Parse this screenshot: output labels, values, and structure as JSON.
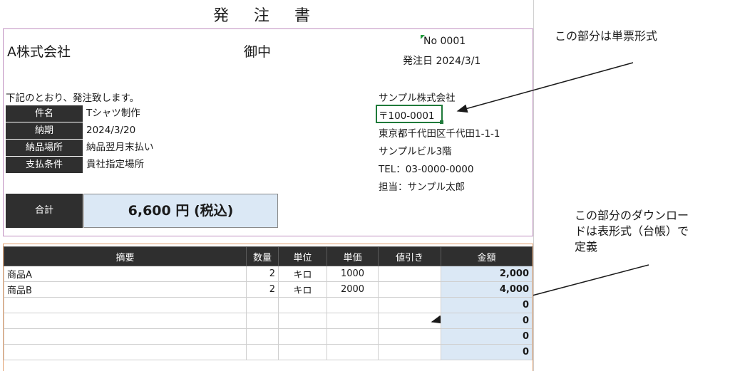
{
  "title": "発 注 書",
  "recipient": {
    "company": "A株式会社",
    "suffix": "御中"
  },
  "order": {
    "no_label": "No",
    "no": "0001",
    "date_label": "発注日",
    "date": "2024/3/1"
  },
  "intro": "下記のとおり、発注致します。",
  "fields": [
    {
      "label": "件名",
      "value": "Tシャツ制作"
    },
    {
      "label": "納期",
      "value": "2024/3/20"
    },
    {
      "label": "納品場所",
      "value": "納品翌月末払い"
    },
    {
      "label": "支払条件",
      "value": "貴社指定場所"
    }
  ],
  "total": {
    "label": "合計",
    "value": "6,600 円 (税込)"
  },
  "sender": {
    "company": "サンプル株式会社",
    "postal": "〒100-0001",
    "address": "東京都千代田区千代田1-1-1",
    "building": "サンプルビル3階",
    "tel": "TEL：03-0000-0000",
    "contact": "担当：サンプル太郎"
  },
  "annotations": {
    "form_note": "この部分は単票形式",
    "table_note_lines": [
      "この部分のダウンロー",
      "ドは表形式（台帳）で",
      "定義"
    ]
  },
  "table": {
    "headers": [
      "摘要",
      "数量",
      "単位",
      "単価",
      "値引き",
      "金額"
    ],
    "rows": [
      [
        "商品A",
        "2",
        "キロ",
        "1000",
        "",
        "2,000"
      ],
      [
        "商品B",
        "2",
        "キロ",
        "2000",
        "",
        "4,000"
      ],
      [
        "",
        "",
        "",
        "",
        "",
        "0"
      ],
      [
        "",
        "",
        "",
        "",
        "",
        "0"
      ],
      [
        "",
        "",
        "",
        "",
        "",
        "0"
      ],
      [
        "",
        "",
        "",
        "",
        "",
        "0"
      ]
    ]
  }
}
